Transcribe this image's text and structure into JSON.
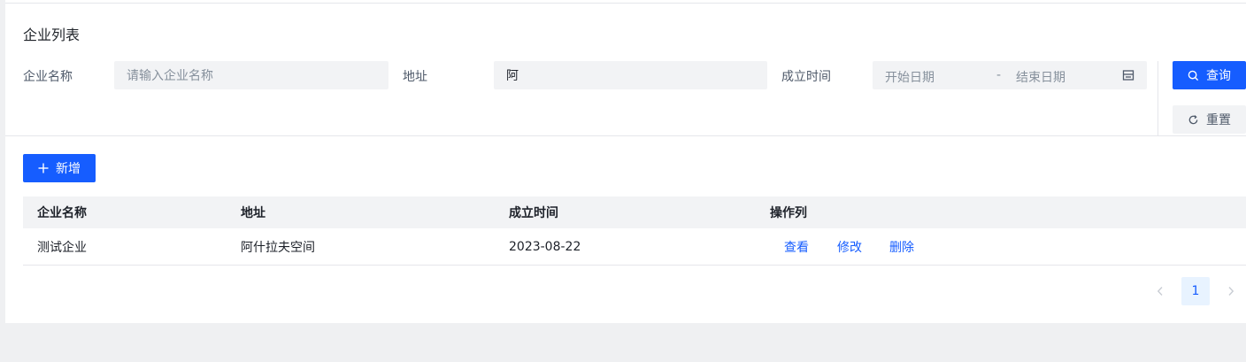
{
  "page": {
    "title": "企业列表"
  },
  "filters": {
    "name": {
      "label": "企业名称",
      "placeholder": "请输入企业名称",
      "value": ""
    },
    "address": {
      "label": "地址",
      "value": "阿"
    },
    "founded": {
      "label": "成立时间",
      "start_placeholder": "开始日期",
      "separator": "-",
      "end_placeholder": "结束日期"
    }
  },
  "actions": {
    "search_label": "查询",
    "reset_label": "重置",
    "add_label": "新增"
  },
  "table": {
    "columns": [
      "企业名称",
      "地址",
      "成立时间",
      "操作列"
    ],
    "rows": [
      {
        "name": "测试企业",
        "address": "阿什拉夫空间",
        "founded": "2023-08-22",
        "actions": [
          "查看",
          "修改",
          "删除"
        ]
      }
    ]
  },
  "pagination": {
    "current_page": "1"
  },
  "colors": {
    "primary": "#165dff",
    "page_bg": "#eff0f2",
    "input_bg": "#f2f3f5"
  }
}
